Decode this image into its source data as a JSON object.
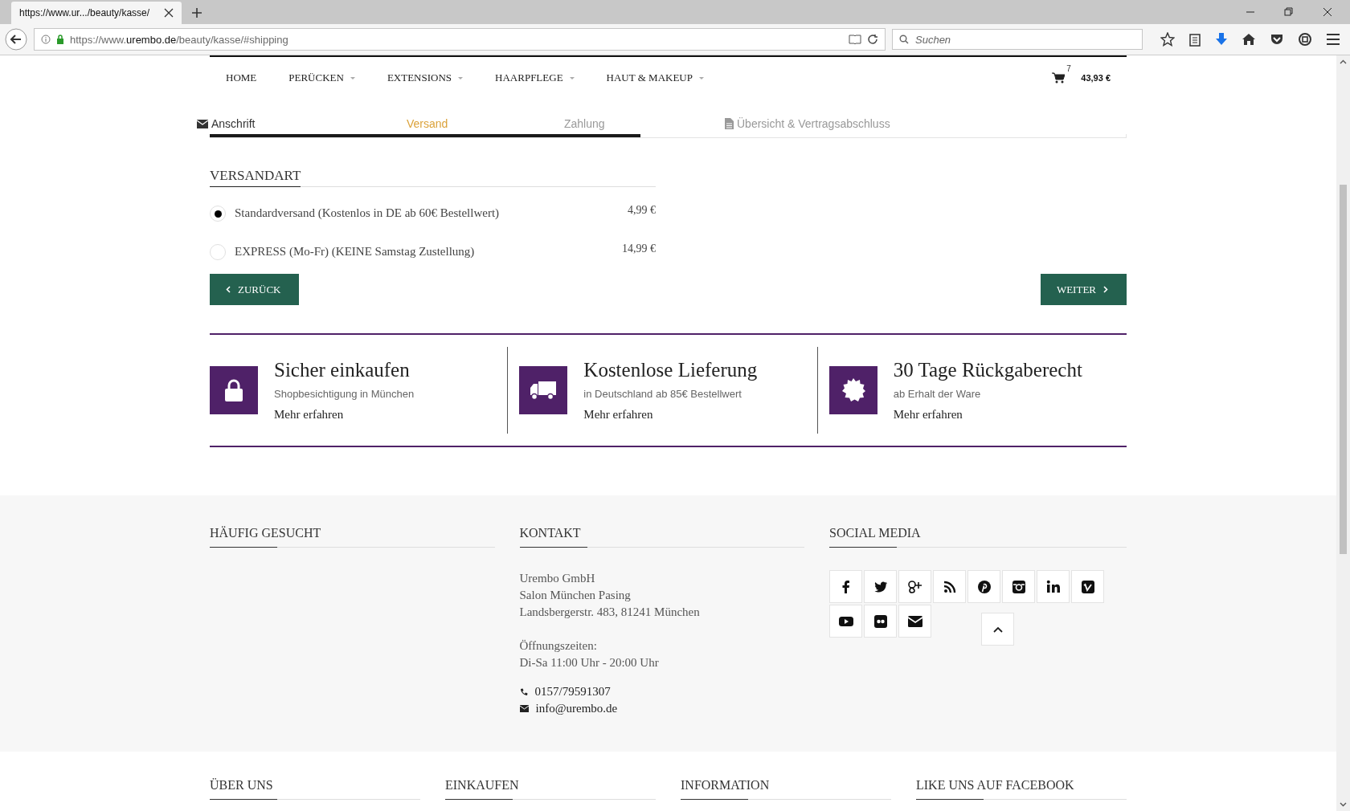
{
  "browser": {
    "tab_title": "https://www.ur.../beauty/kasse/",
    "url": {
      "prefix": "https://www.",
      "domain": "urembo.de",
      "path": "/beauty/kasse/#shipping"
    },
    "search": {
      "placeholder": "Suchen"
    }
  },
  "nav": {
    "items": [
      {
        "label": "HOME",
        "dropdown": false
      },
      {
        "label": "PERÜCKEN",
        "dropdown": true
      },
      {
        "label": "EXTENSIONS",
        "dropdown": true
      },
      {
        "label": "HAARPFLEGE",
        "dropdown": true
      },
      {
        "label": "HAUT & MAKEUP",
        "dropdown": true
      }
    ],
    "cart": {
      "count": "7",
      "total": "43,93 €"
    }
  },
  "steps": {
    "items": [
      {
        "label": "Anschrift",
        "kind": "envelope",
        "completed": true,
        "selected": false
      },
      {
        "label": "Versand",
        "kind": "plain",
        "completed": false,
        "selected": true
      },
      {
        "label": "Zahlung",
        "kind": "plain",
        "completed": false,
        "selected": false
      },
      {
        "label": "Übersicht & Vertragsabschluss",
        "kind": "document",
        "completed": false,
        "selected": false
      }
    ],
    "level": 0.47
  },
  "shipping": {
    "title": "VERSANDART",
    "options": [
      {
        "label": "Standardversand (Kostenlos in DE ab 60€ Bestellwert)",
        "price": "4,99 €",
        "selected": true
      },
      {
        "label": "EXPRESS (Mo-Fr) (KEINE Samstag Zustellung)",
        "price": "14,99 €",
        "selected": false
      }
    ],
    "back_button": "ZURÜCK",
    "next_button": "WEITER"
  },
  "features": [
    {
      "kind": "lock",
      "title": "Sicher einkaufen",
      "subtitle": "Shopbesichtigung in München",
      "link": "Mehr erfahren"
    },
    {
      "kind": "truck",
      "title": "Kostenlose Lieferung",
      "subtitle": "in Deutschland ab 85€ Bestellwert",
      "link": "Mehr erfahren"
    },
    {
      "kind": "seal",
      "title": "30 Tage Rückgaberecht",
      "subtitle": "ab Erhalt der Ware",
      "link": "Mehr erfahren"
    }
  ],
  "footer": {
    "searched": {
      "title": "HÄUFIG GESUCHT"
    },
    "contact": {
      "title": "KONTAKT",
      "address": [
        "Urembo GmbH",
        "Salon München Pasing",
        "Landsbergerstr. 483, 81241 München"
      ],
      "hours": [
        "Öffnungszeiten:",
        "Di-Sa 11:00 Uhr - 20:00 Uhr"
      ],
      "phone": "0157/79591307",
      "email": "info@urembo.de"
    },
    "social": {
      "title": "SOCIAL MEDIA",
      "icons": [
        {
          "kind": "facebook"
        },
        {
          "kind": "twitter"
        },
        {
          "kind": "googleplus"
        },
        {
          "kind": "rss"
        },
        {
          "kind": "pinterest"
        },
        {
          "kind": "instagram"
        },
        {
          "kind": "linkedin"
        },
        {
          "kind": "vimeo"
        },
        {
          "kind": "youtube"
        },
        {
          "kind": "flickr"
        },
        {
          "kind": "email"
        }
      ]
    }
  },
  "bottom": {
    "titles": [
      "ÜBER UNS",
      "EINKAUFEN",
      "INFORMATION",
      "LIKE UNS AUF FACEBOOK"
    ]
  }
}
